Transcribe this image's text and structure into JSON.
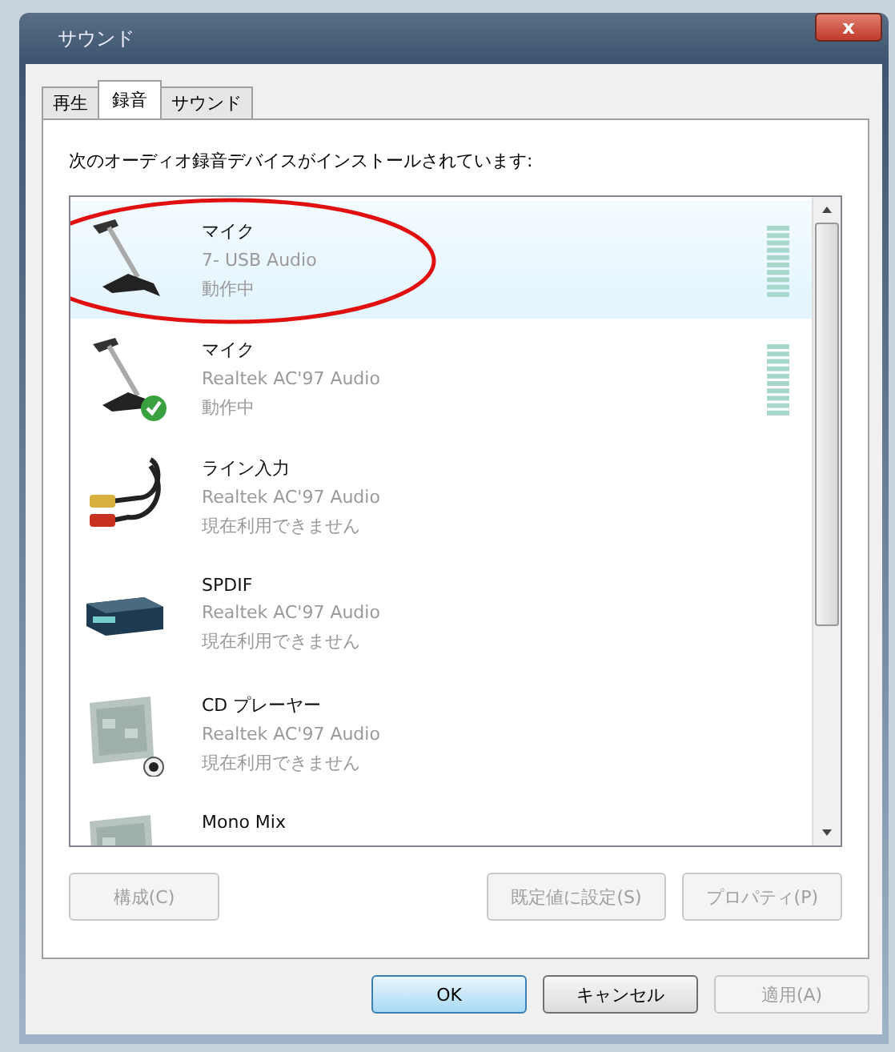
{
  "window": {
    "title": "サウンド",
    "close": "x"
  },
  "tabs": [
    {
      "label": "再生",
      "selected": false
    },
    {
      "label": "録音",
      "selected": true
    },
    {
      "label": "サウンド",
      "selected": false
    }
  ],
  "intro": "次のオーディオ録音デバイスがインストールされています:",
  "devices": [
    {
      "kind": "mic",
      "name": "マイク",
      "driver": "7- USB Audio",
      "status": "動作中",
      "selected": true,
      "circled": true,
      "default": false,
      "meter": true,
      "jack": false
    },
    {
      "kind": "mic",
      "name": "マイク",
      "driver": "Realtek AC'97 Audio",
      "status": "動作中",
      "selected": false,
      "circled": false,
      "default": true,
      "meter": true,
      "jack": false
    },
    {
      "kind": "cable",
      "name": "ライン入力",
      "driver": "Realtek AC'97 Audio",
      "status": "現在利用できません",
      "selected": false,
      "circled": false,
      "default": false,
      "meter": false,
      "jack": false
    },
    {
      "kind": "box",
      "name": "SPDIF",
      "driver": "Realtek AC'97 Audio",
      "status": "現在利用できません",
      "selected": false,
      "circled": false,
      "default": false,
      "meter": false,
      "jack": false
    },
    {
      "kind": "card",
      "name": "CD プレーヤー",
      "driver": "Realtek AC'97 Audio",
      "status": "現在利用できません",
      "selected": false,
      "circled": false,
      "default": false,
      "meter": false,
      "jack": true
    },
    {
      "kind": "card",
      "name": "Mono Mix",
      "selected": false,
      "circled": false,
      "default": false,
      "meter": false,
      "jack": false
    }
  ],
  "panel_buttons": [
    {
      "label": "構成(C)",
      "disabled": true
    },
    {
      "label": "既定値に設定(S)",
      "disabled": true
    },
    {
      "label": "プロパティ(P)",
      "disabled": true
    }
  ],
  "dialog_buttons": [
    {
      "label": "OK",
      "disabled": false,
      "default": true
    },
    {
      "label": "キャンセル",
      "disabled": false,
      "default": false
    },
    {
      "label": "適用(A)",
      "disabled": true,
      "default": false
    }
  ]
}
